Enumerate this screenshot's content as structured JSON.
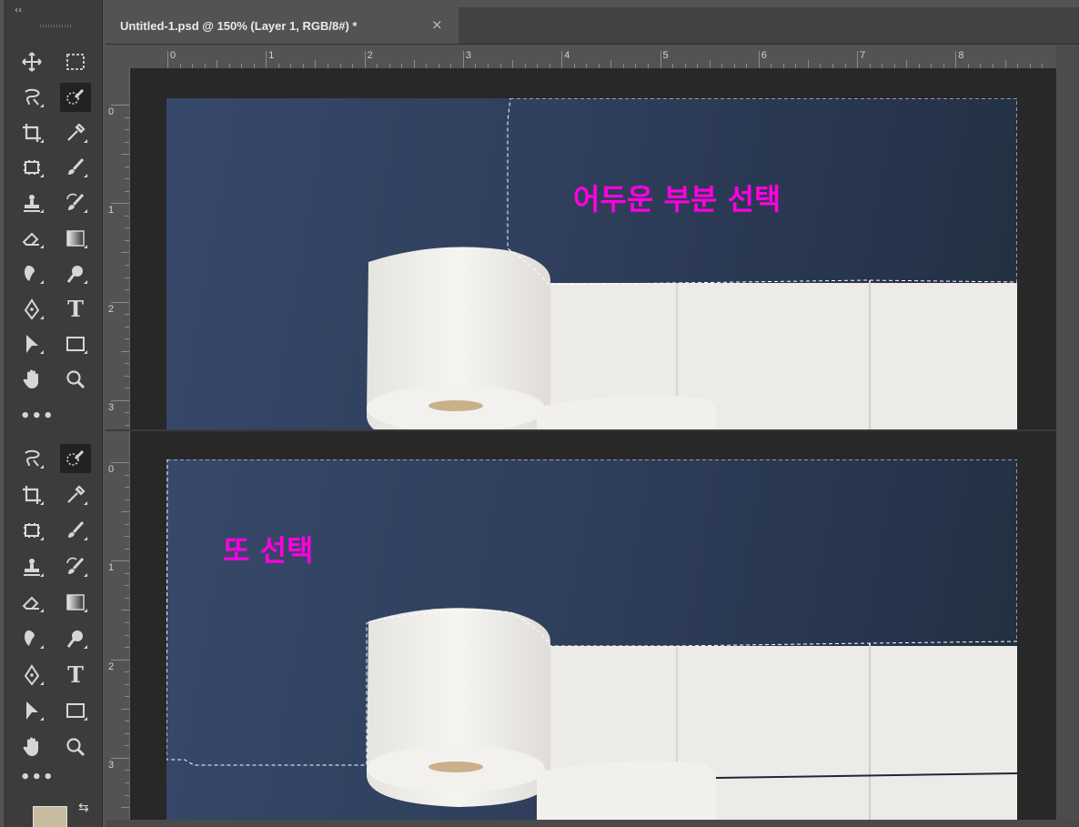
{
  "document": {
    "tab_title": "Untitled-1.psd @ 150% (Layer 1, RGB/8#) *",
    "close_glyph": "×"
  },
  "toolbar": {
    "collapse_glyph": "‹‹",
    "more_glyph": "•••",
    "tools": [
      {
        "name": "move-tool-icon"
      },
      {
        "name": "marquee-tool-icon"
      },
      {
        "name": "lasso-tool-icon"
      },
      {
        "name": "quick-selection-tool-icon",
        "selected": true
      },
      {
        "name": "crop-tool-icon"
      },
      {
        "name": "eyedropper-tool-icon"
      },
      {
        "name": "frame-tool-icon"
      },
      {
        "name": "brush-tool-icon"
      },
      {
        "name": "stamp-tool-icon"
      },
      {
        "name": "history-brush-tool-icon"
      },
      {
        "name": "eraser-tool-icon"
      },
      {
        "name": "gradient-tool-icon"
      },
      {
        "name": "smudge-tool-icon"
      },
      {
        "name": "dodge-tool-icon"
      },
      {
        "name": "pen-tool-icon"
      },
      {
        "name": "type-tool-icon",
        "glyph": "T"
      },
      {
        "name": "path-selection-tool-icon"
      },
      {
        "name": "rectangle-tool-icon"
      },
      {
        "name": "hand-tool-icon"
      },
      {
        "name": "zoom-tool-icon"
      }
    ],
    "swap_glyph": "⇆"
  },
  "ruler": {
    "horizontal_labels": [
      "0",
      "1",
      "2",
      "3",
      "4",
      "5",
      "6",
      "7",
      "8"
    ],
    "vertical_labels": [
      "0",
      "1",
      "2",
      "3"
    ]
  },
  "annotations": {
    "top": "어두운 부분 선택",
    "bottom": "또 선택"
  },
  "colors": {
    "annotation": "#ff00e0",
    "foreground_swatch": "#c8bba0",
    "background": "#535353"
  }
}
